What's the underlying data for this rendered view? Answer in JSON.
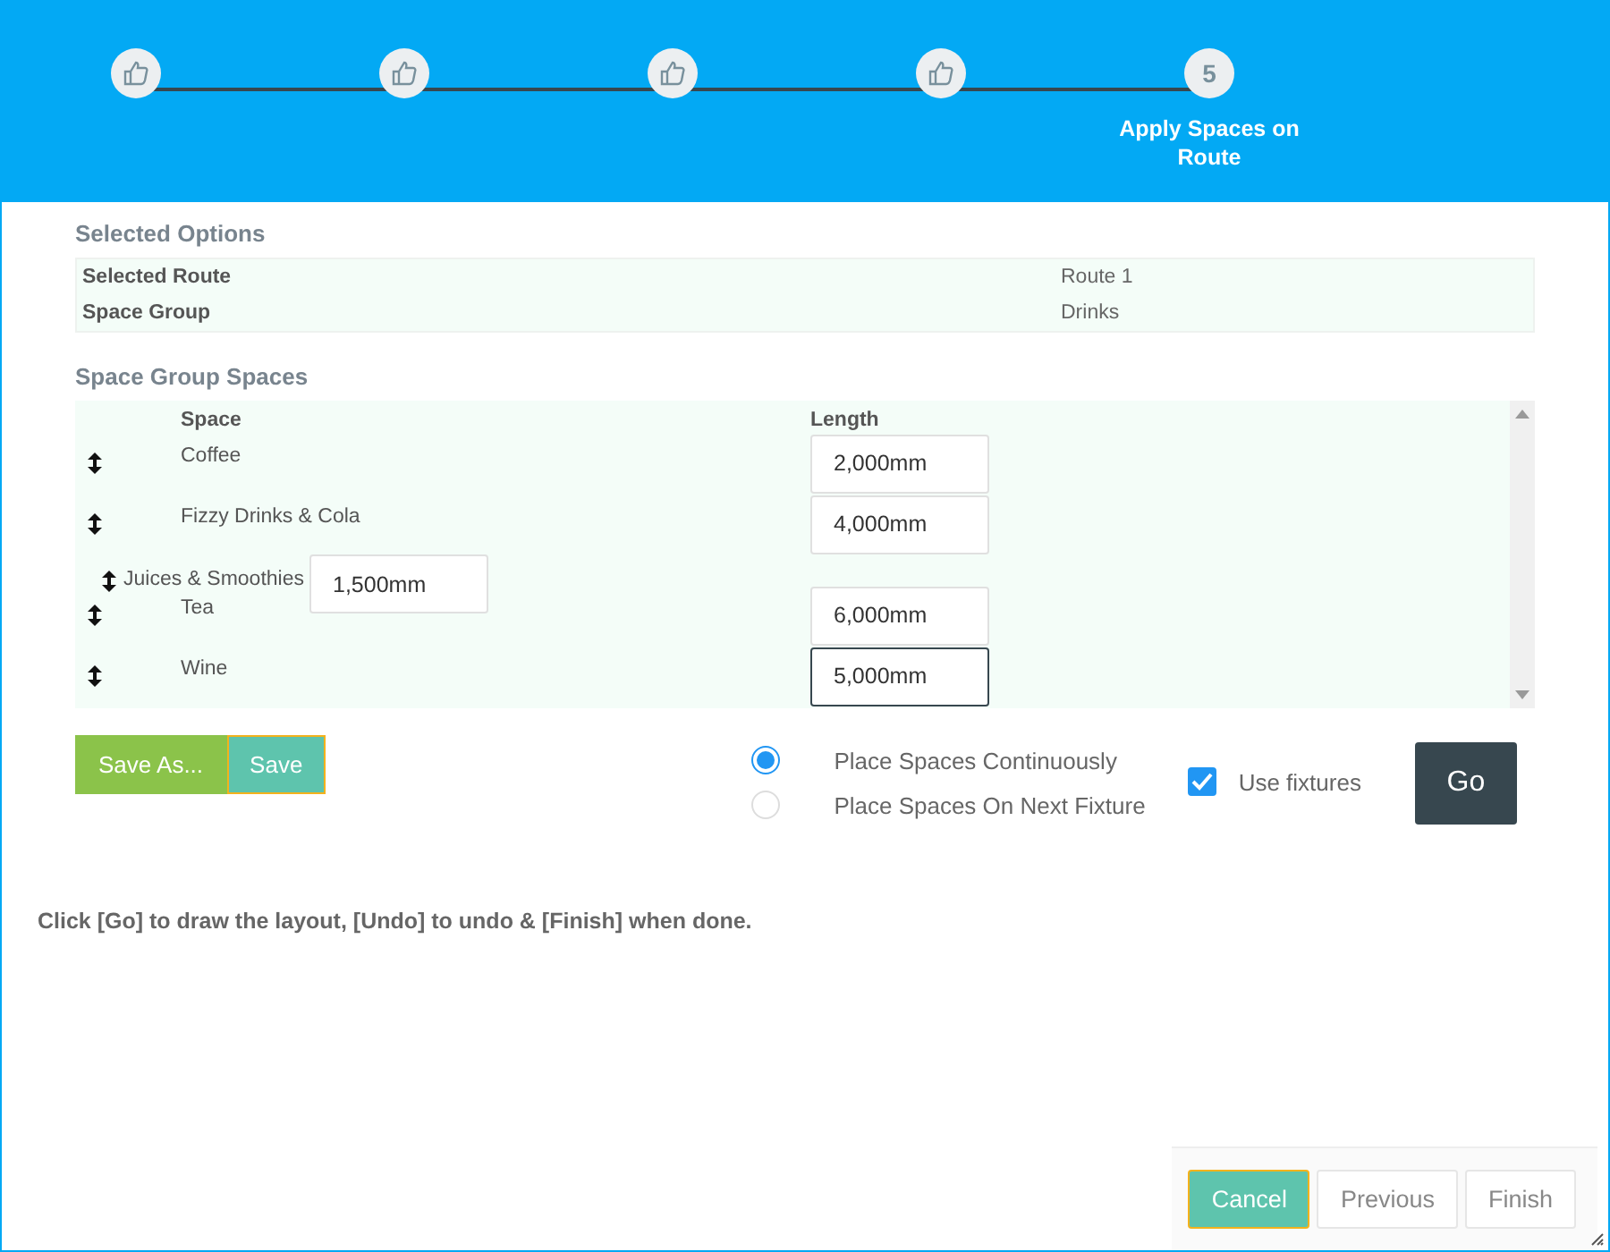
{
  "steps": [
    {
      "done": true
    },
    {
      "done": true
    },
    {
      "done": true
    },
    {
      "done": true
    },
    {
      "number": "5",
      "done": false,
      "label": "Apply Spaces on Route"
    }
  ],
  "selected_options": {
    "title": "Selected Options",
    "rows": [
      {
        "label": "Selected Route",
        "value": "Route 1"
      },
      {
        "label": "Space Group",
        "value": "Drinks"
      }
    ]
  },
  "spaces": {
    "title": "Space Group Spaces",
    "columns": [
      "Space",
      "Length"
    ],
    "rows": [
      {
        "kind": "normal",
        "name": "Coffee",
        "length": "2,000mm",
        "focused": false
      },
      {
        "kind": "normal",
        "name": "Fizzy Drinks & Cola",
        "length": "4,000mm",
        "focused": false
      },
      {
        "kind": "inline",
        "name": "Juices & Smoothies",
        "length": "1,500mm",
        "focused": false
      },
      {
        "kind": "normal",
        "name": "Tea",
        "length": "6,000mm",
        "focused": false
      },
      {
        "kind": "normal",
        "name": "Wine",
        "length": "5,000mm",
        "focused": true
      }
    ]
  },
  "save_buttons": [
    "Save As...",
    "Save"
  ],
  "placement": [
    {
      "label": "Place Spaces Continuously",
      "selected": true
    },
    {
      "label": "Place Spaces On Next Fixture",
      "selected": false
    }
  ],
  "use_fixtures": {
    "label": "Use fixtures",
    "checked": true
  },
  "go_button": "Go",
  "hint": "Click [Go] to draw the layout, [Undo] to undo & [Finish] when done.",
  "footer_buttons": [
    {
      "label": "Cancel",
      "kind": "primary"
    },
    {
      "label": "Previous",
      "kind": "default"
    },
    {
      "label": "Finish",
      "kind": "default"
    }
  ]
}
